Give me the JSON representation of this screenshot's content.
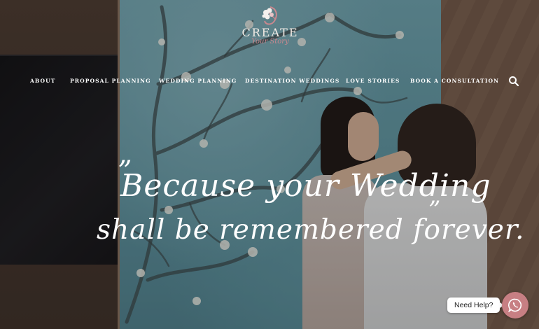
{
  "logo": {
    "title": "CREATE",
    "subtitle": "Your Story",
    "accent_color": "#c9888f"
  },
  "nav": {
    "items": [
      {
        "label": "ABOUT"
      },
      {
        "label": "PROPOSAL PLANNING"
      },
      {
        "label": "WEDDING PLANNING"
      },
      {
        "label": "DESTINATION WEDDINGS"
      },
      {
        "label": "LOVE STORIES"
      },
      {
        "label": "BOOK A CONSULTATION"
      }
    ],
    "search_icon": "search-icon"
  },
  "hero": {
    "quote_open": "”",
    "quote_line1": "Because your Wedding",
    "quote_line2": "shall be remembered forever.",
    "quote_close": "”"
  },
  "help": {
    "label": "Need Help?",
    "icon": "whatsapp-icon",
    "button_color": "#c77f83"
  }
}
